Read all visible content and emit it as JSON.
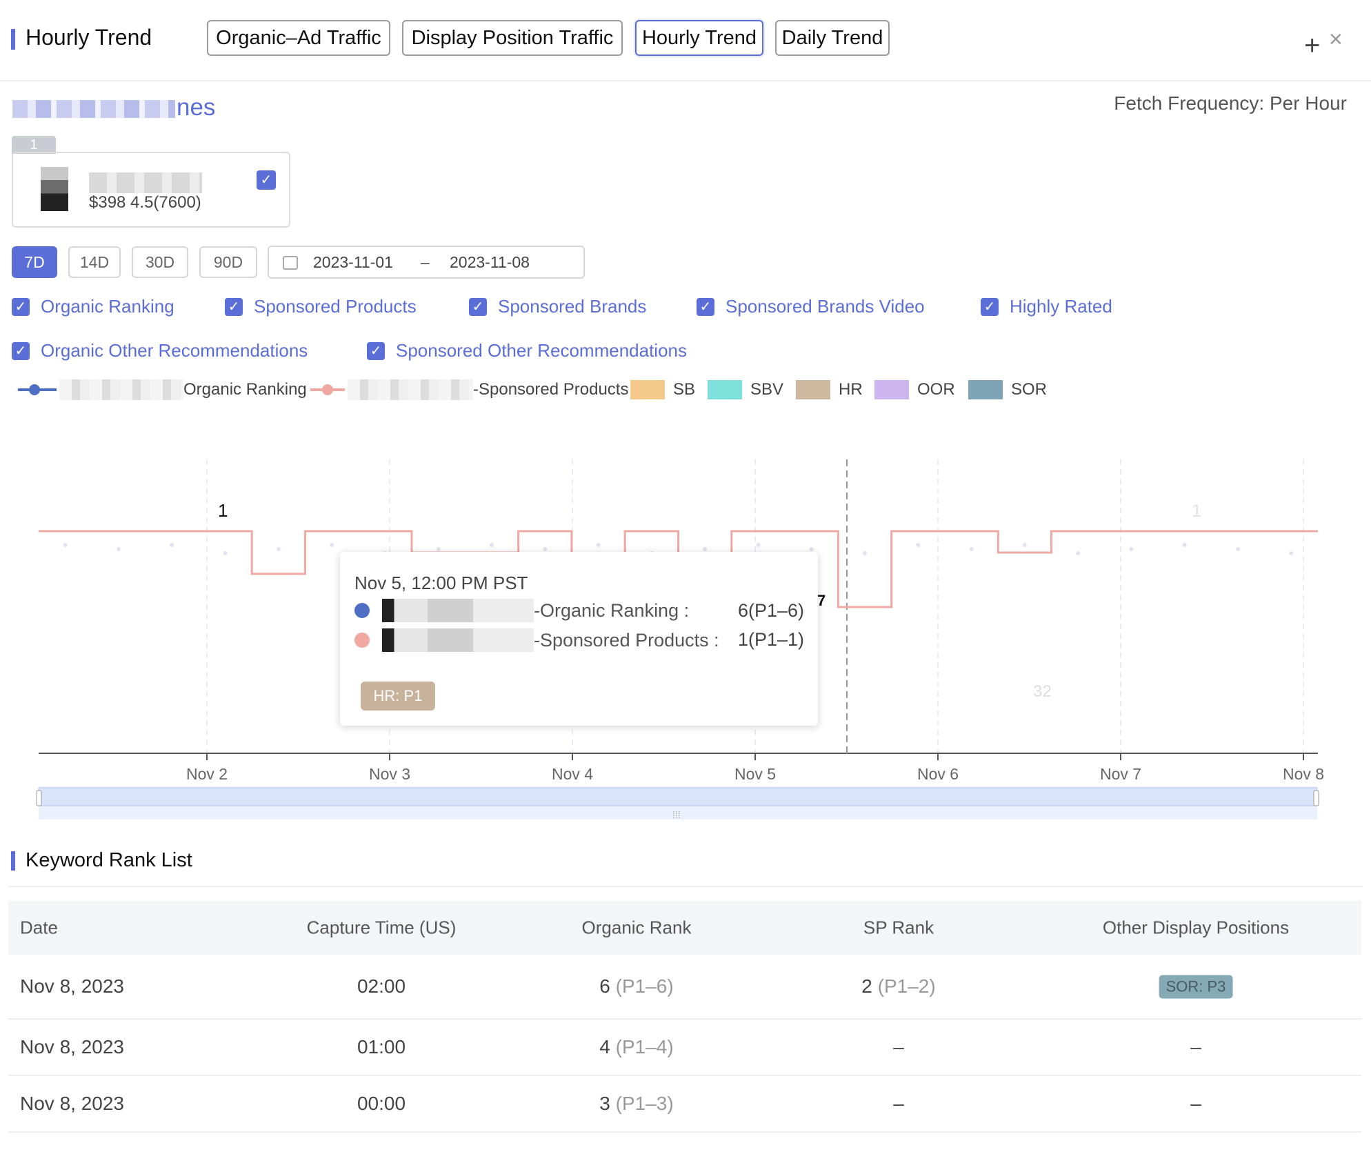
{
  "header": {
    "title": "Hourly Trend",
    "tabs": [
      {
        "label": "Organic–Ad Traffic",
        "active": false
      },
      {
        "label": "Display Position Traffic",
        "active": false
      },
      {
        "label": "Hourly Trend",
        "active": true
      },
      {
        "label": "Daily Trend",
        "active": false
      }
    ],
    "plus_glyph": "+",
    "close_glyph": "×"
  },
  "keyword": {
    "title_suffix": "nes",
    "fetch_frequency": "Fetch Frequency: Per Hour"
  },
  "product_card": {
    "tag": "1",
    "price_line": "$398 4.5(7600)",
    "checked": true
  },
  "date_controls": {
    "ranges": [
      "7D",
      "14D",
      "30D",
      "90D"
    ],
    "active_range": "7D",
    "start_date": "2023-11-01",
    "separator": "–",
    "end_date": "2023-11-08"
  },
  "filters": [
    {
      "label": "Organic Ranking",
      "checked": true
    },
    {
      "label": "Sponsored Products",
      "checked": true
    },
    {
      "label": "Sponsored Brands",
      "checked": true
    },
    {
      "label": "Sponsored Brands Video",
      "checked": true
    },
    {
      "label": "Highly Rated",
      "checked": true
    },
    {
      "label": "Organic Other Recommendations",
      "checked": true
    },
    {
      "label": "Sponsored Other Recommendations",
      "checked": true
    }
  ],
  "legend": {
    "organic": "Organic Ranking",
    "sponsored": "-Sponsored Products",
    "swatches": [
      {
        "label": "SB",
        "color": "#f5c98a"
      },
      {
        "label": "SBV",
        "color": "#7fdfdb"
      },
      {
        "label": "HR",
        "color": "#cdb79f"
      },
      {
        "label": "OOR",
        "color": "#cdb6f0"
      },
      {
        "label": "SOR",
        "color": "#7ea5b5"
      }
    ],
    "colors": {
      "organic": "#4f6fc5",
      "sponsored": "#f0a8a3"
    }
  },
  "chart_labels": {
    "top_value": "1",
    "right_top_value": "1",
    "marker_value": "7",
    "low_value": "32"
  },
  "chart_data": {
    "type": "line",
    "x_ticks": [
      "Nov 2",
      "Nov 3",
      "Nov 4",
      "Nov 5",
      "Nov 6",
      "Nov 7",
      "Nov 8"
    ],
    "series": [
      {
        "name": "Organic Ranking",
        "values": [
          4,
          5,
          4,
          6,
          5,
          4,
          6,
          5,
          4,
          5,
          4,
          6,
          5,
          4,
          5,
          6,
          4,
          5,
          4,
          6,
          5,
          4,
          5,
          6
        ]
      },
      {
        "name": "Sponsored Products",
        "values": [
          1,
          1,
          1,
          1,
          3,
          1,
          1,
          2,
          2,
          1,
          3,
          1,
          3,
          1,
          1,
          7,
          1,
          1,
          2,
          1,
          1,
          1,
          1,
          1
        ]
      }
    ],
    "yrange": [
      1,
      32
    ],
    "y_inverted": true,
    "grid": "vertical-dashed",
    "legend_position": "top"
  },
  "tooltip": {
    "time": "Nov 5, 12:00 PM PST",
    "organic_label": "-Organic Ranking :",
    "organic_value": "6(P1–6)",
    "sp_label": "-Sponsored Products :",
    "sp_value": "1(P1–1)",
    "badge": "HR: P1"
  },
  "rank_list": {
    "title": "Keyword Rank List",
    "columns": [
      "Date",
      "Capture Time (US)",
      "Organic Rank",
      "SP Rank",
      "Other Display Positions"
    ],
    "rows": [
      {
        "date": "Nov 8, 2023",
        "time": "02:00",
        "organic": "6",
        "organic_pos": "(P1–6)",
        "sp": "2",
        "sp_pos": "(P1–2)",
        "other": "SOR: P3"
      },
      {
        "date": "Nov 8, 2023",
        "time": "01:00",
        "organic": "4",
        "organic_pos": "(P1–4)",
        "sp": "–",
        "sp_pos": "",
        "other": "–"
      },
      {
        "date": "Nov 8, 2023",
        "time": "00:00",
        "organic": "3",
        "organic_pos": "(P1–3)",
        "sp": "–",
        "sp_pos": "",
        "other": "–"
      }
    ]
  }
}
